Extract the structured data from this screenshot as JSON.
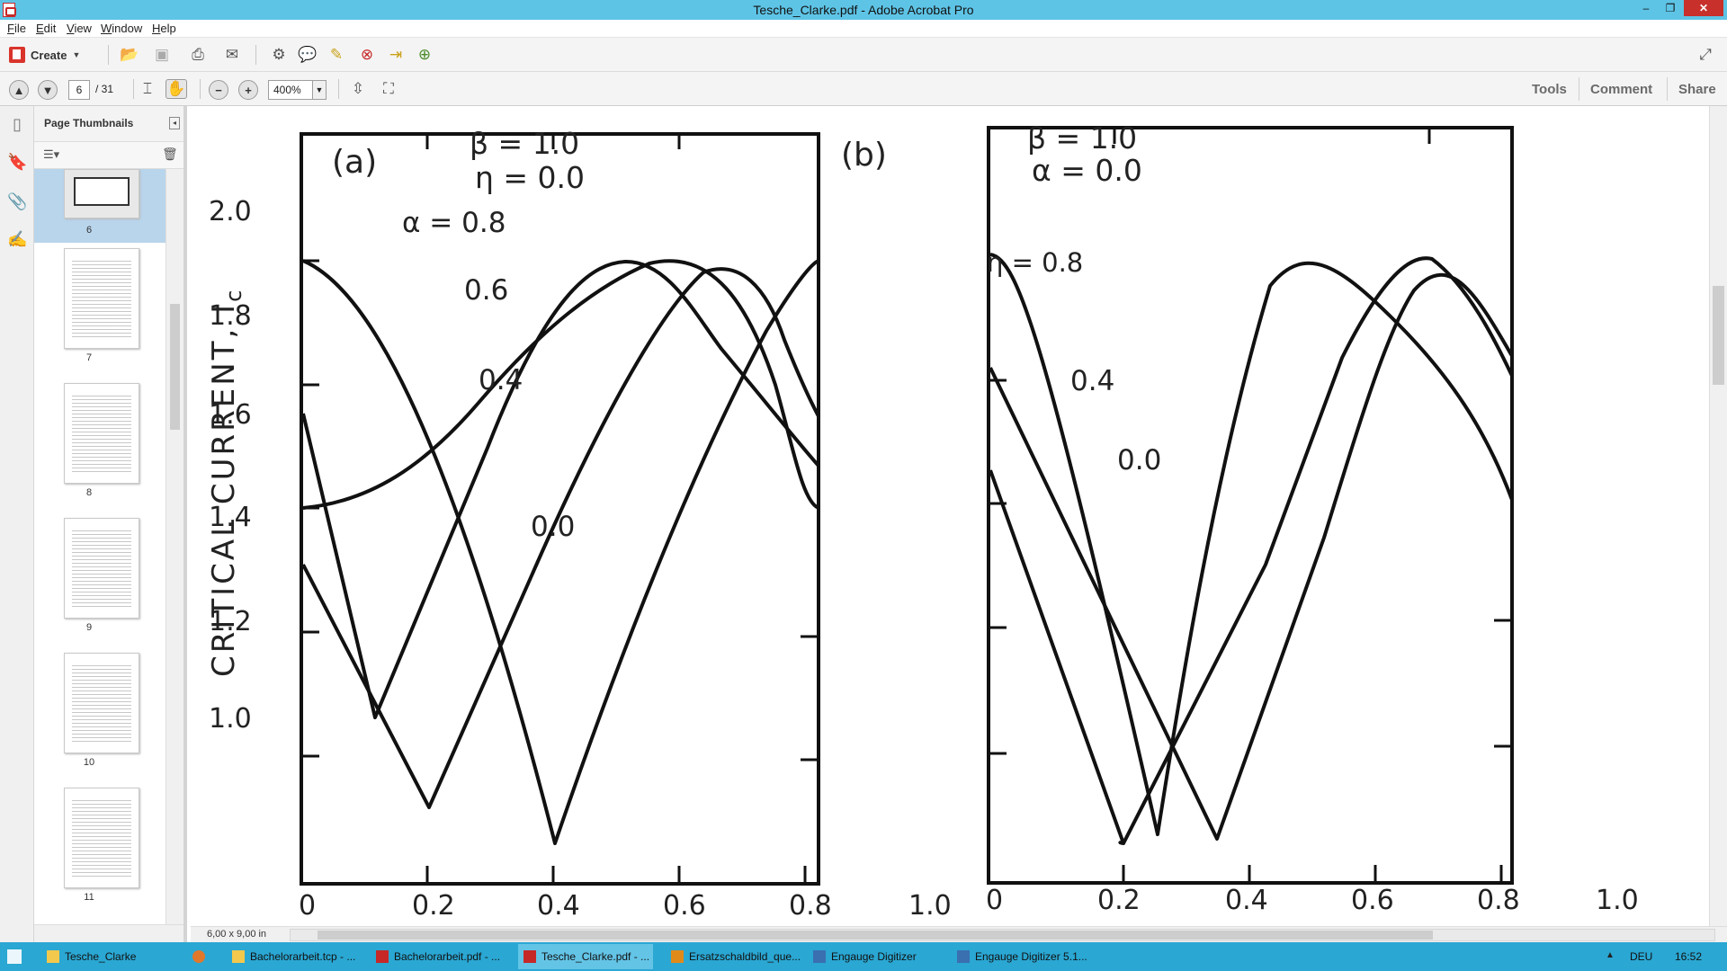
{
  "window": {
    "title": "Tesche_Clarke.pdf - Adobe Acrobat Pro",
    "controls": [
      "–",
      "❐",
      "✕"
    ]
  },
  "menu": [
    "File",
    "Edit",
    "View",
    "Window",
    "Help"
  ],
  "toolbar": {
    "create_label": "Create",
    "page_current": "6",
    "page_total": "/ 31",
    "zoom": "400%",
    "right_tabs": [
      "Tools",
      "Comment",
      "Share"
    ]
  },
  "sidebar": {
    "title": "Page Thumbnails",
    "thumbnails": [
      {
        "label": "6"
      },
      {
        "label": "7"
      },
      {
        "label": "8"
      },
      {
        "label": "9"
      },
      {
        "label": "10"
      },
      {
        "label": "11"
      }
    ]
  },
  "document": {
    "page_size": "6,00 x 9,00 in",
    "figure": {
      "panel_a": {
        "label": "(a)",
        "params": [
          "β = 1.0",
          "η = 0.0"
        ],
        "curve_labels": [
          "α = 0.8",
          "0.6",
          "0.4",
          "0.0"
        ]
      },
      "panel_b": {
        "label": "(b)",
        "params": [
          "β = 1.0",
          "α = 0.0"
        ],
        "curve_labels": [
          "η = 0.8",
          "0.4",
          "0.0"
        ]
      },
      "y_axis_label": "CRITICAL CURRENT, I",
      "y_axis_subscript": "c",
      "y_ticks": [
        "2.0",
        "1.8",
        "1.6",
        "1.4",
        "1.2",
        "1.0"
      ],
      "x_ticks_a": [
        "0",
        "0.2",
        "0.4",
        "0.6",
        "0.8",
        "1.0"
      ],
      "x_ticks_b": [
        "0",
        "0.2",
        "0.4",
        "0.6",
        "0.8",
        "1.0"
      ]
    }
  },
  "taskbar": {
    "items": [
      {
        "label": "Tesche_Clarke",
        "color": "#f2c94c"
      },
      {
        "label": "Bachelorarbeit.tcp - ...",
        "color": "#f2c94c"
      },
      {
        "label": "",
        "color": "#e0782c"
      },
      {
        "label": "Bachelorarbeit.pdf - ...",
        "color": "#c62828"
      },
      {
        "label": "Tesche_Clarke.pdf - ...",
        "color": "#c62828"
      },
      {
        "label": "Ersatzschaldbild_que...",
        "color": "#e08a1a"
      },
      {
        "label": "Engauge Digitizer",
        "color": "#3a6fb0"
      },
      {
        "label": "Engauge Digitizer 5.1...",
        "color": "#3a6fb0"
      }
    ],
    "language": "DEU",
    "time": "16:52"
  }
}
